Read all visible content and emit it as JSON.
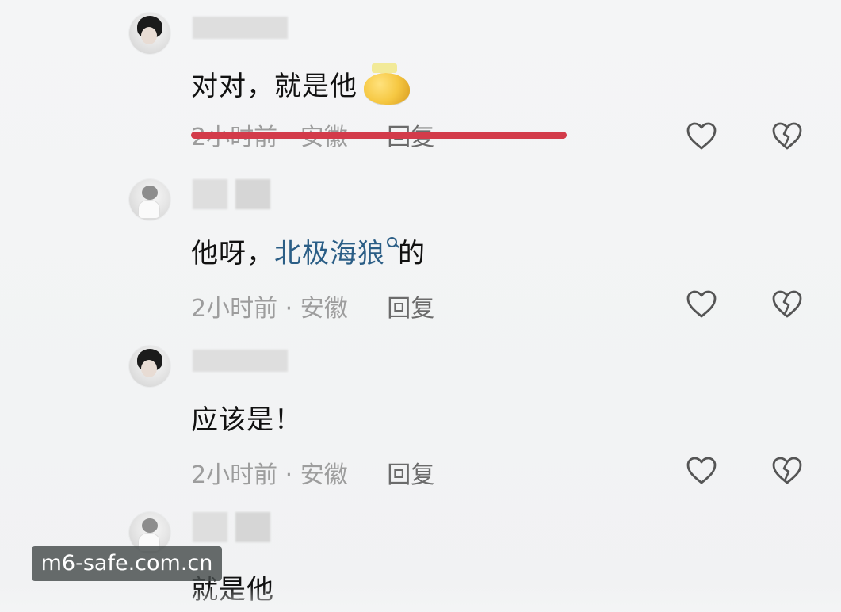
{
  "comments": [
    {
      "username_suffix": "",
      "text": "对对，就是他",
      "emoji": "crying-face-emoji",
      "meta": "2小时前 · 安徽",
      "reply_label": "回复",
      "struck_out": true
    },
    {
      "username_suffix": "",
      "text_prefix": "他呀，",
      "link_text": "北极海狼",
      "text_suffix": "的",
      "meta": "2小时前 · 安徽",
      "reply_label": "回复",
      "struck_out": false
    },
    {
      "username_suffix": "",
      "text": "应该是！",
      "meta": "2小时前 · 安徽",
      "reply_label": "回复",
      "struck_out": false
    },
    {
      "username_suffix": "",
      "text": "就是他",
      "struck_out": false
    }
  ],
  "icons": {
    "like": "heart-outline-icon",
    "dislike": "broken-heart-icon",
    "search": "search-icon"
  },
  "colors": {
    "link": "#2b5e86",
    "strike": "#d33b4a",
    "meta_text": "#9d9d9d",
    "body_text": "#111111"
  },
  "watermark": {
    "text": "m6-safe.com.cn"
  }
}
